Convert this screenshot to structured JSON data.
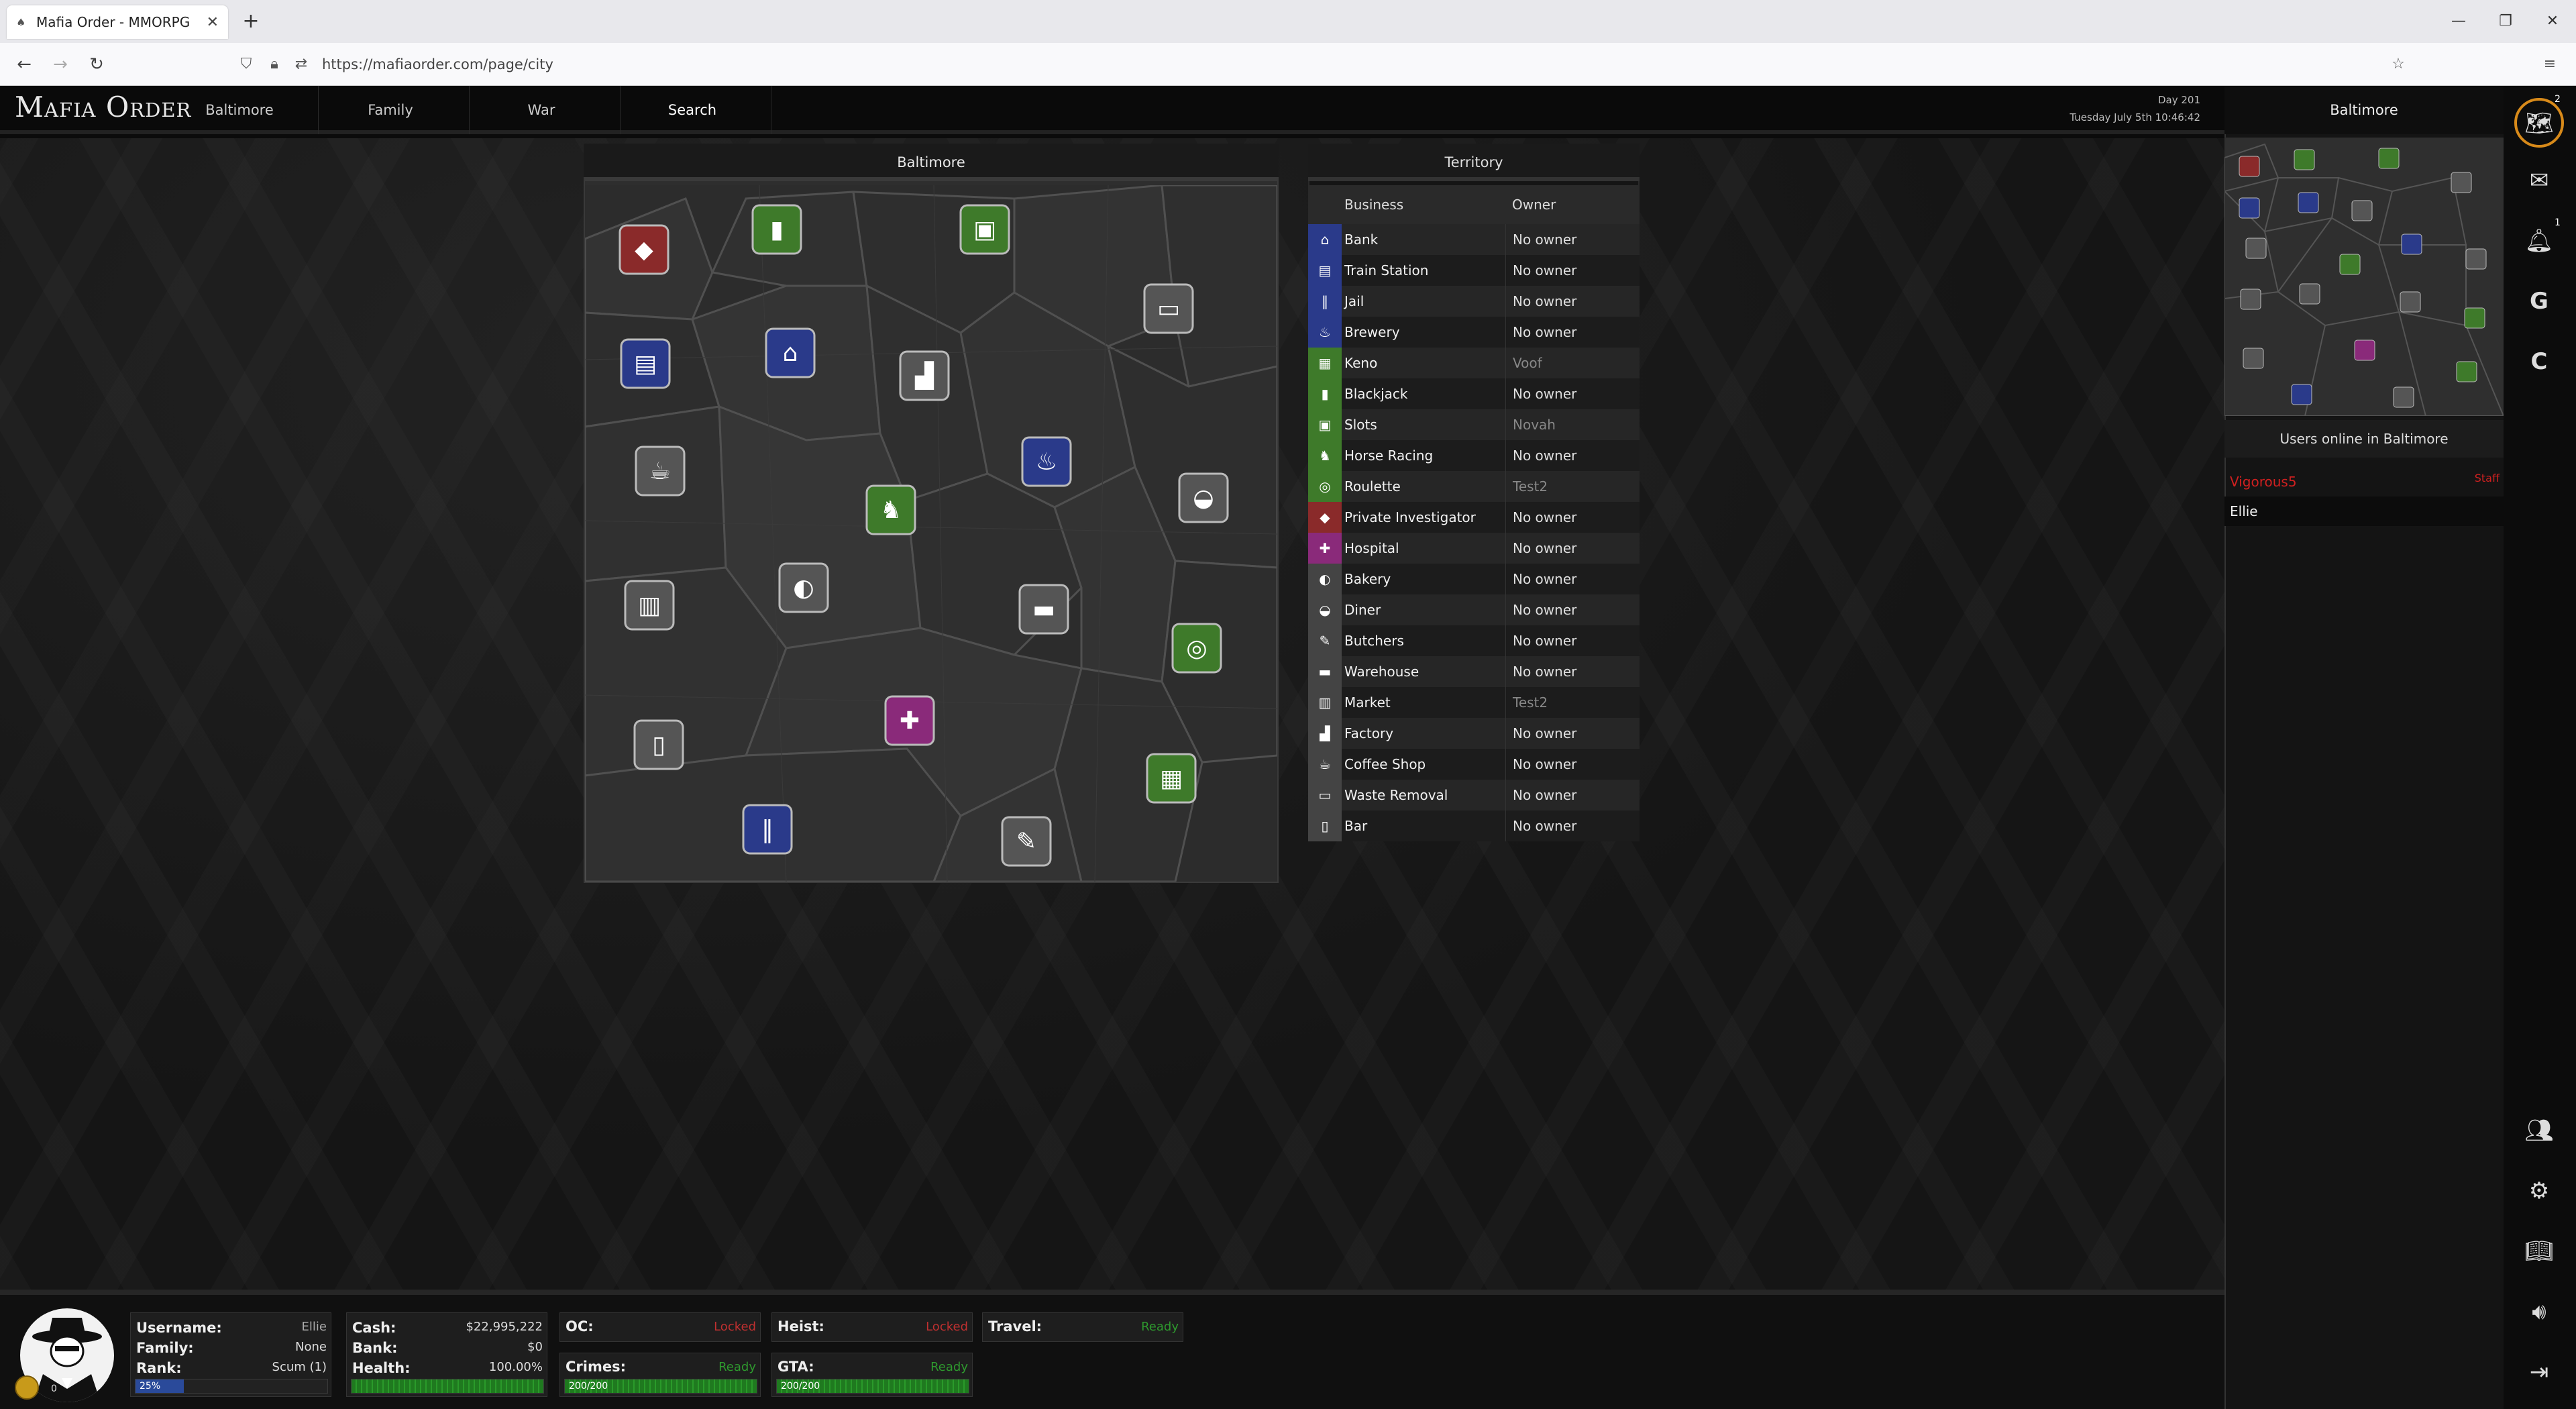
{
  "browser": {
    "tab_title": "Mafia Order - MMORPG",
    "url": "https://mafiaorder.com/page/city",
    "new_tab": "+",
    "minimize": "—",
    "restore": "❐",
    "close": "✕"
  },
  "site": {
    "logo": "Mafia Order",
    "nav": [
      "Baltimore",
      "Family",
      "War",
      "Search"
    ],
    "day": "Day 201",
    "datetime": "Tuesday July 5th 10:46:42"
  },
  "city": {
    "title": "Baltimore"
  },
  "territory": {
    "title": "Territory",
    "col_business": "Business",
    "col_owner": "Owner",
    "rows": [
      {
        "business": "Bank",
        "owner": "No owner",
        "color": "#2a3a8a",
        "icon": "⌂",
        "dim": false
      },
      {
        "business": "Train Station",
        "owner": "No owner",
        "color": "#2a3a8a",
        "icon": "▤",
        "dim": false
      },
      {
        "business": "Jail",
        "owner": "No owner",
        "color": "#2a3a8a",
        "icon": "‖",
        "dim": false
      },
      {
        "business": "Brewery",
        "owner": "No owner",
        "color": "#2a3a8a",
        "icon": "♨",
        "dim": false
      },
      {
        "business": "Keno",
        "owner": "Voof",
        "color": "#3e7a2a",
        "icon": "▦",
        "dim": true
      },
      {
        "business": "Blackjack",
        "owner": "No owner",
        "color": "#3e7a2a",
        "icon": "▮",
        "dim": false
      },
      {
        "business": "Slots",
        "owner": "Novah",
        "color": "#3e7a2a",
        "icon": "▣",
        "dim": true
      },
      {
        "business": "Horse Racing",
        "owner": "No owner",
        "color": "#3e7a2a",
        "icon": "♞",
        "dim": false
      },
      {
        "business": "Roulette",
        "owner": "Test2",
        "color": "#3e7a2a",
        "icon": "◎",
        "dim": true
      },
      {
        "business": "Private Investigator",
        "owner": "No owner",
        "color": "#8a2a2a",
        "icon": "◆",
        "dim": false
      },
      {
        "business": "Hospital",
        "owner": "No owner",
        "color": "#8a2a7a",
        "icon": "✚",
        "dim": false
      },
      {
        "business": "Bakery",
        "owner": "No owner",
        "color": "#444",
        "icon": "◐",
        "dim": false
      },
      {
        "business": "Diner",
        "owner": "No owner",
        "color": "#444",
        "icon": "◒",
        "dim": false
      },
      {
        "business": "Butchers",
        "owner": "No owner",
        "color": "#444",
        "icon": "✎",
        "dim": false
      },
      {
        "business": "Warehouse",
        "owner": "No owner",
        "color": "#444",
        "icon": "▬",
        "dim": false
      },
      {
        "business": "Market",
        "owner": "Test2",
        "color": "#444",
        "icon": "▥",
        "dim": true
      },
      {
        "business": "Factory",
        "owner": "No owner",
        "color": "#444",
        "icon": "▟",
        "dim": false
      },
      {
        "business": "Coffee Shop",
        "owner": "No owner",
        "color": "#444",
        "icon": "☕",
        "dim": false
      },
      {
        "business": "Waste Removal",
        "owner": "No owner",
        "color": "#444",
        "icon": "▭",
        "dim": false
      },
      {
        "business": "Bar",
        "owner": "No owner",
        "color": "#444",
        "icon": "▯",
        "dim": false
      }
    ]
  },
  "sidebar": {
    "title": "Baltimore",
    "users_heading": "Users online in Baltimore",
    "users": [
      {
        "name": "Vigorous5",
        "tag": "Staff",
        "color": "#d02020"
      },
      {
        "name": "Ellie",
        "tag": "",
        "color": "#f0f0f0"
      }
    ],
    "icon_badges": {
      "map": "2",
      "notifications": "1"
    },
    "icons": [
      "map-icon",
      "mail-icon",
      "bell-icon",
      "g-icon",
      "c-icon",
      "users-icon",
      "gear-icon",
      "book-icon",
      "volume-icon",
      "logout-icon"
    ]
  },
  "status": {
    "username_label": "Username:",
    "username": "Ellie",
    "family_label": "Family:",
    "family": "None",
    "rank_label": "Rank:",
    "rank": "Scum (1)",
    "rank_progress": "25%",
    "rank_progress_value": 25,
    "cash_label": "Cash:",
    "cash": "$22,995,222",
    "bank_label": "Bank:",
    "bank": "$0",
    "health_label": "Health:",
    "health": "100.00%",
    "health_value": 100,
    "oc_label": "OC:",
    "oc": "Locked",
    "heist_label": "Heist:",
    "heist": "Locked",
    "travel_label": "Travel:",
    "travel": "Ready",
    "crimes_label": "Crimes:",
    "crimes": "Ready",
    "crimes_bar": "200/200",
    "crimes_value": 100,
    "gta_label": "GTA:",
    "gta": "Ready",
    "gta_bar": "200/200",
    "gta_value": 100,
    "coins": "0"
  },
  "colors": {
    "ready": "#2e9a2e",
    "locked": "#c03030",
    "staff": "#d02020"
  }
}
